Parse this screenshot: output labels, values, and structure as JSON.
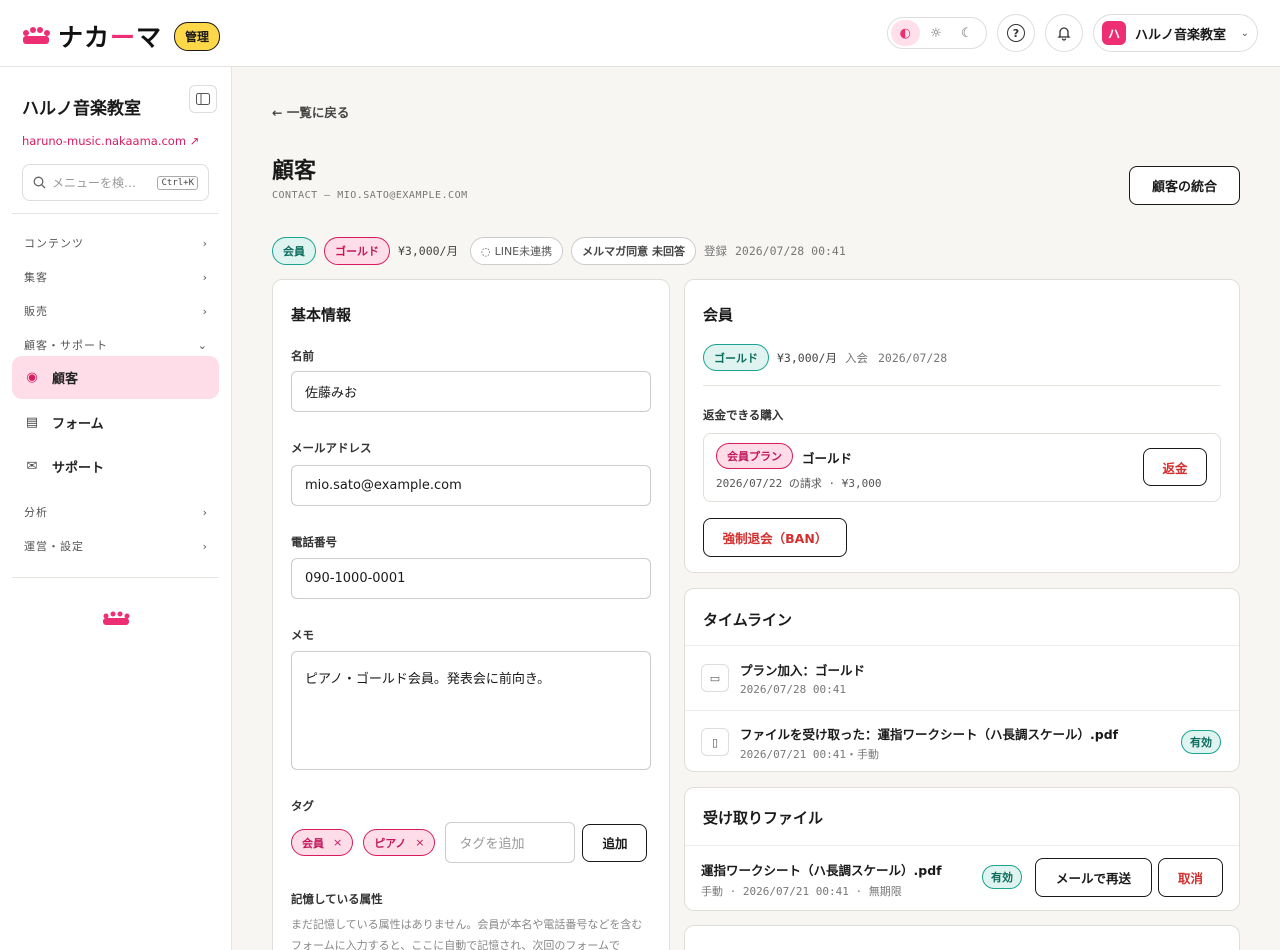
{
  "header": {
    "brand": "ナカ",
    "brand_dash": "ー",
    "brand_tail": "マ",
    "admin_badge": "管理",
    "theme_icons": [
      "◐",
      "☼",
      "☾"
    ],
    "help_icon": "?",
    "account_avatar": "ハ",
    "account_name": "ハルノ音楽教室"
  },
  "sidebar": {
    "title": "ハルノ音楽教室",
    "url": "haruno-music.nakaama.com",
    "search_placeholder": "メニューを検…",
    "search_shortcut": "Ctrl+K",
    "sections": {
      "content": "コンテンツ",
      "attract": "集客",
      "sales": "販売",
      "customer_support": "顧客・サポート",
      "analytics": "分析",
      "operations": "運営・設定"
    },
    "items": {
      "customers": "顧客",
      "forms": "フォーム",
      "support": "サポート"
    }
  },
  "page": {
    "back": "一覧に戻る",
    "title": "顧客",
    "subtitle": "CONTACT — MIO.SATO@EXAMPLE.COM",
    "merge_button": "顧客の統合",
    "meta": {
      "member": "会員",
      "plan": "ゴールド",
      "price": "¥3,000/月",
      "line": "LINE未連携",
      "newsletter": "メルマガ同意 未回答",
      "registered_label": "登録",
      "registered_at": "2026/07/28 00:41"
    }
  },
  "basic_info": {
    "heading": "基本情報",
    "name_label": "名前",
    "name_value": "佐藤みお",
    "email_label": "メールアドレス",
    "email_value": "mio.sato@example.com",
    "phone_label": "電話番号",
    "phone_value": "090-1000-0001",
    "memo_label": "メモ",
    "memo_value": "ピアノ・ゴールド会員。発表会に前向き。",
    "tags_label": "タグ",
    "tags": [
      "会員",
      "ピアノ"
    ],
    "tag_placeholder": "タグを追加",
    "add_button": "追加",
    "attributes_label": "記憶している属性",
    "attributes_note": "まだ記憶している属性はありません。会員が本名や電話番号などを含むフォームに入力すると、ここに自動で記憶され、次回のフォームで"
  },
  "membership": {
    "heading": "会員",
    "plan": "ゴールド",
    "price": "¥3,000/月",
    "joined_label": "入会",
    "joined_at": "2026/07/28",
    "refundable_label": "返金できる購入",
    "purchase_tag": "会員プラン",
    "purchase_name": "ゴールド",
    "purchase_meta": "2026/07/22 の請求 · ¥3,000",
    "refund_button": "返金",
    "ban_button": "強制退会（BAN）"
  },
  "timeline": {
    "heading": "タイムライン",
    "events": [
      {
        "title": "プラン加入：ゴールド",
        "meta": "2026/07/28 00:41",
        "icon": "card-icon"
      },
      {
        "title": "ファイルを受け取った：運指ワークシート（ハ長調スケール）.pdf",
        "meta": "2026/07/21 00:41・手動",
        "badge": "有効",
        "icon": "document-icon"
      }
    ]
  },
  "files": {
    "heading": "受け取りファイル",
    "items": [
      {
        "name": "運指ワークシート（ハ長調スケール）.pdf",
        "meta": "手動 · 2026/07/21 00:41 · 無期限",
        "badge": "有効",
        "resend": "メールで再送",
        "cancel": "取消"
      }
    ]
  },
  "colors": {
    "accent": "#ee2e72",
    "teal": "#1aa390",
    "admin": "#ffd84a"
  }
}
